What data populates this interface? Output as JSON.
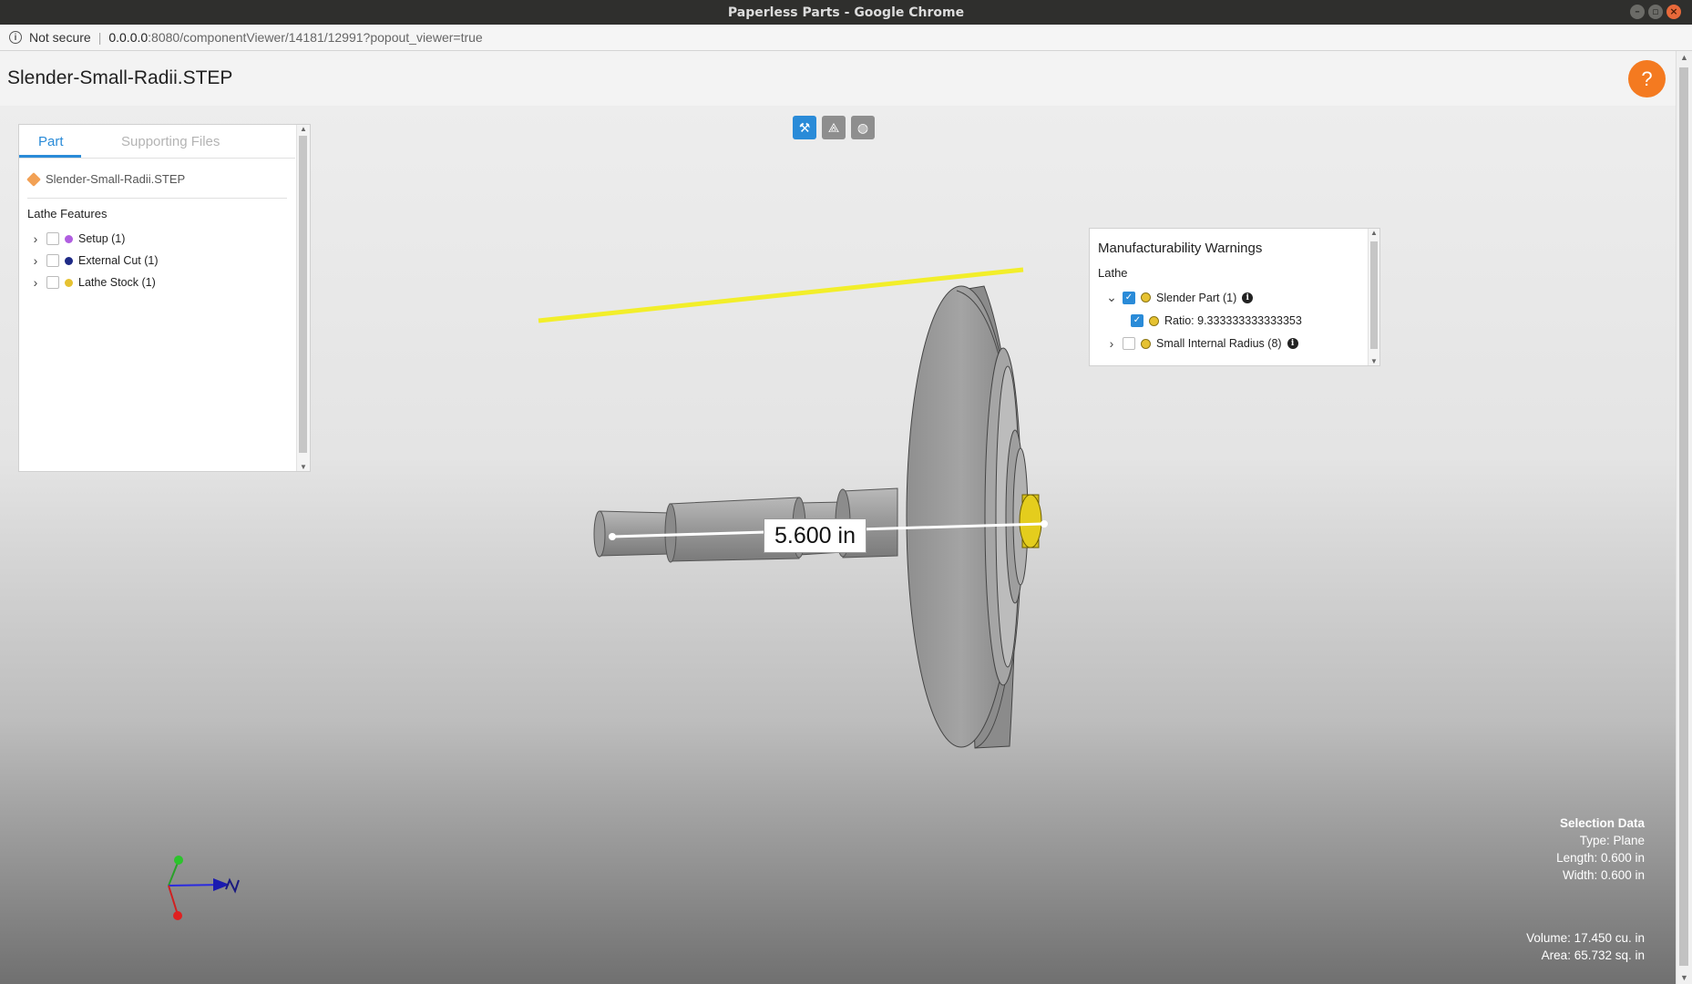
{
  "window": {
    "title": "Paperless Parts - Google Chrome"
  },
  "address": {
    "security_label": "Not secure",
    "url_host": "0.0.0.0",
    "url_path": ":8080/componentViewer/14181/12991?popout_viewer=true"
  },
  "page": {
    "title": "Slender-Small-Radii.STEP",
    "help_label": "?"
  },
  "left_panel": {
    "tabs": [
      {
        "label": "Part"
      },
      {
        "label": "Supporting Files"
      }
    ],
    "file_name": "Slender-Small-Radii.STEP",
    "section_title": "Lathe Features",
    "features": [
      {
        "label": "Setup (1)",
        "color": "#b05ee0"
      },
      {
        "label": "External Cut (1)",
        "color": "#1e2a86"
      },
      {
        "label": "Lathe Stock (1)",
        "color": "#e6c231"
      }
    ]
  },
  "toolbar": {
    "icons": [
      "pick-icon",
      "measure-icon",
      "globe-icon"
    ]
  },
  "warnings": {
    "title": "Manufacturability Warnings",
    "group": "Lathe",
    "items": [
      {
        "label": "Slender Part (1)",
        "checked": true,
        "expanded": true,
        "color": "#e6c231"
      },
      {
        "label": "Ratio: 9.333333333333353",
        "checked": true,
        "color": "#e6c231"
      },
      {
        "label": "Small Internal Radius (8)",
        "checked": false,
        "expanded": false,
        "color": "#e6c231"
      }
    ]
  },
  "measurement": {
    "label": "5.600 in"
  },
  "selection": {
    "title": "Selection Data",
    "type": "Type: Plane",
    "length": "Length: 0.600 in",
    "width": "Width: 0.600 in",
    "volume": "Volume: 17.450 cu. in",
    "area": "Area: 65.732 sq. in"
  },
  "colors": {
    "accent": "#2a8bd8",
    "help": "#f47a20",
    "highlight": "#f2ee2a"
  }
}
